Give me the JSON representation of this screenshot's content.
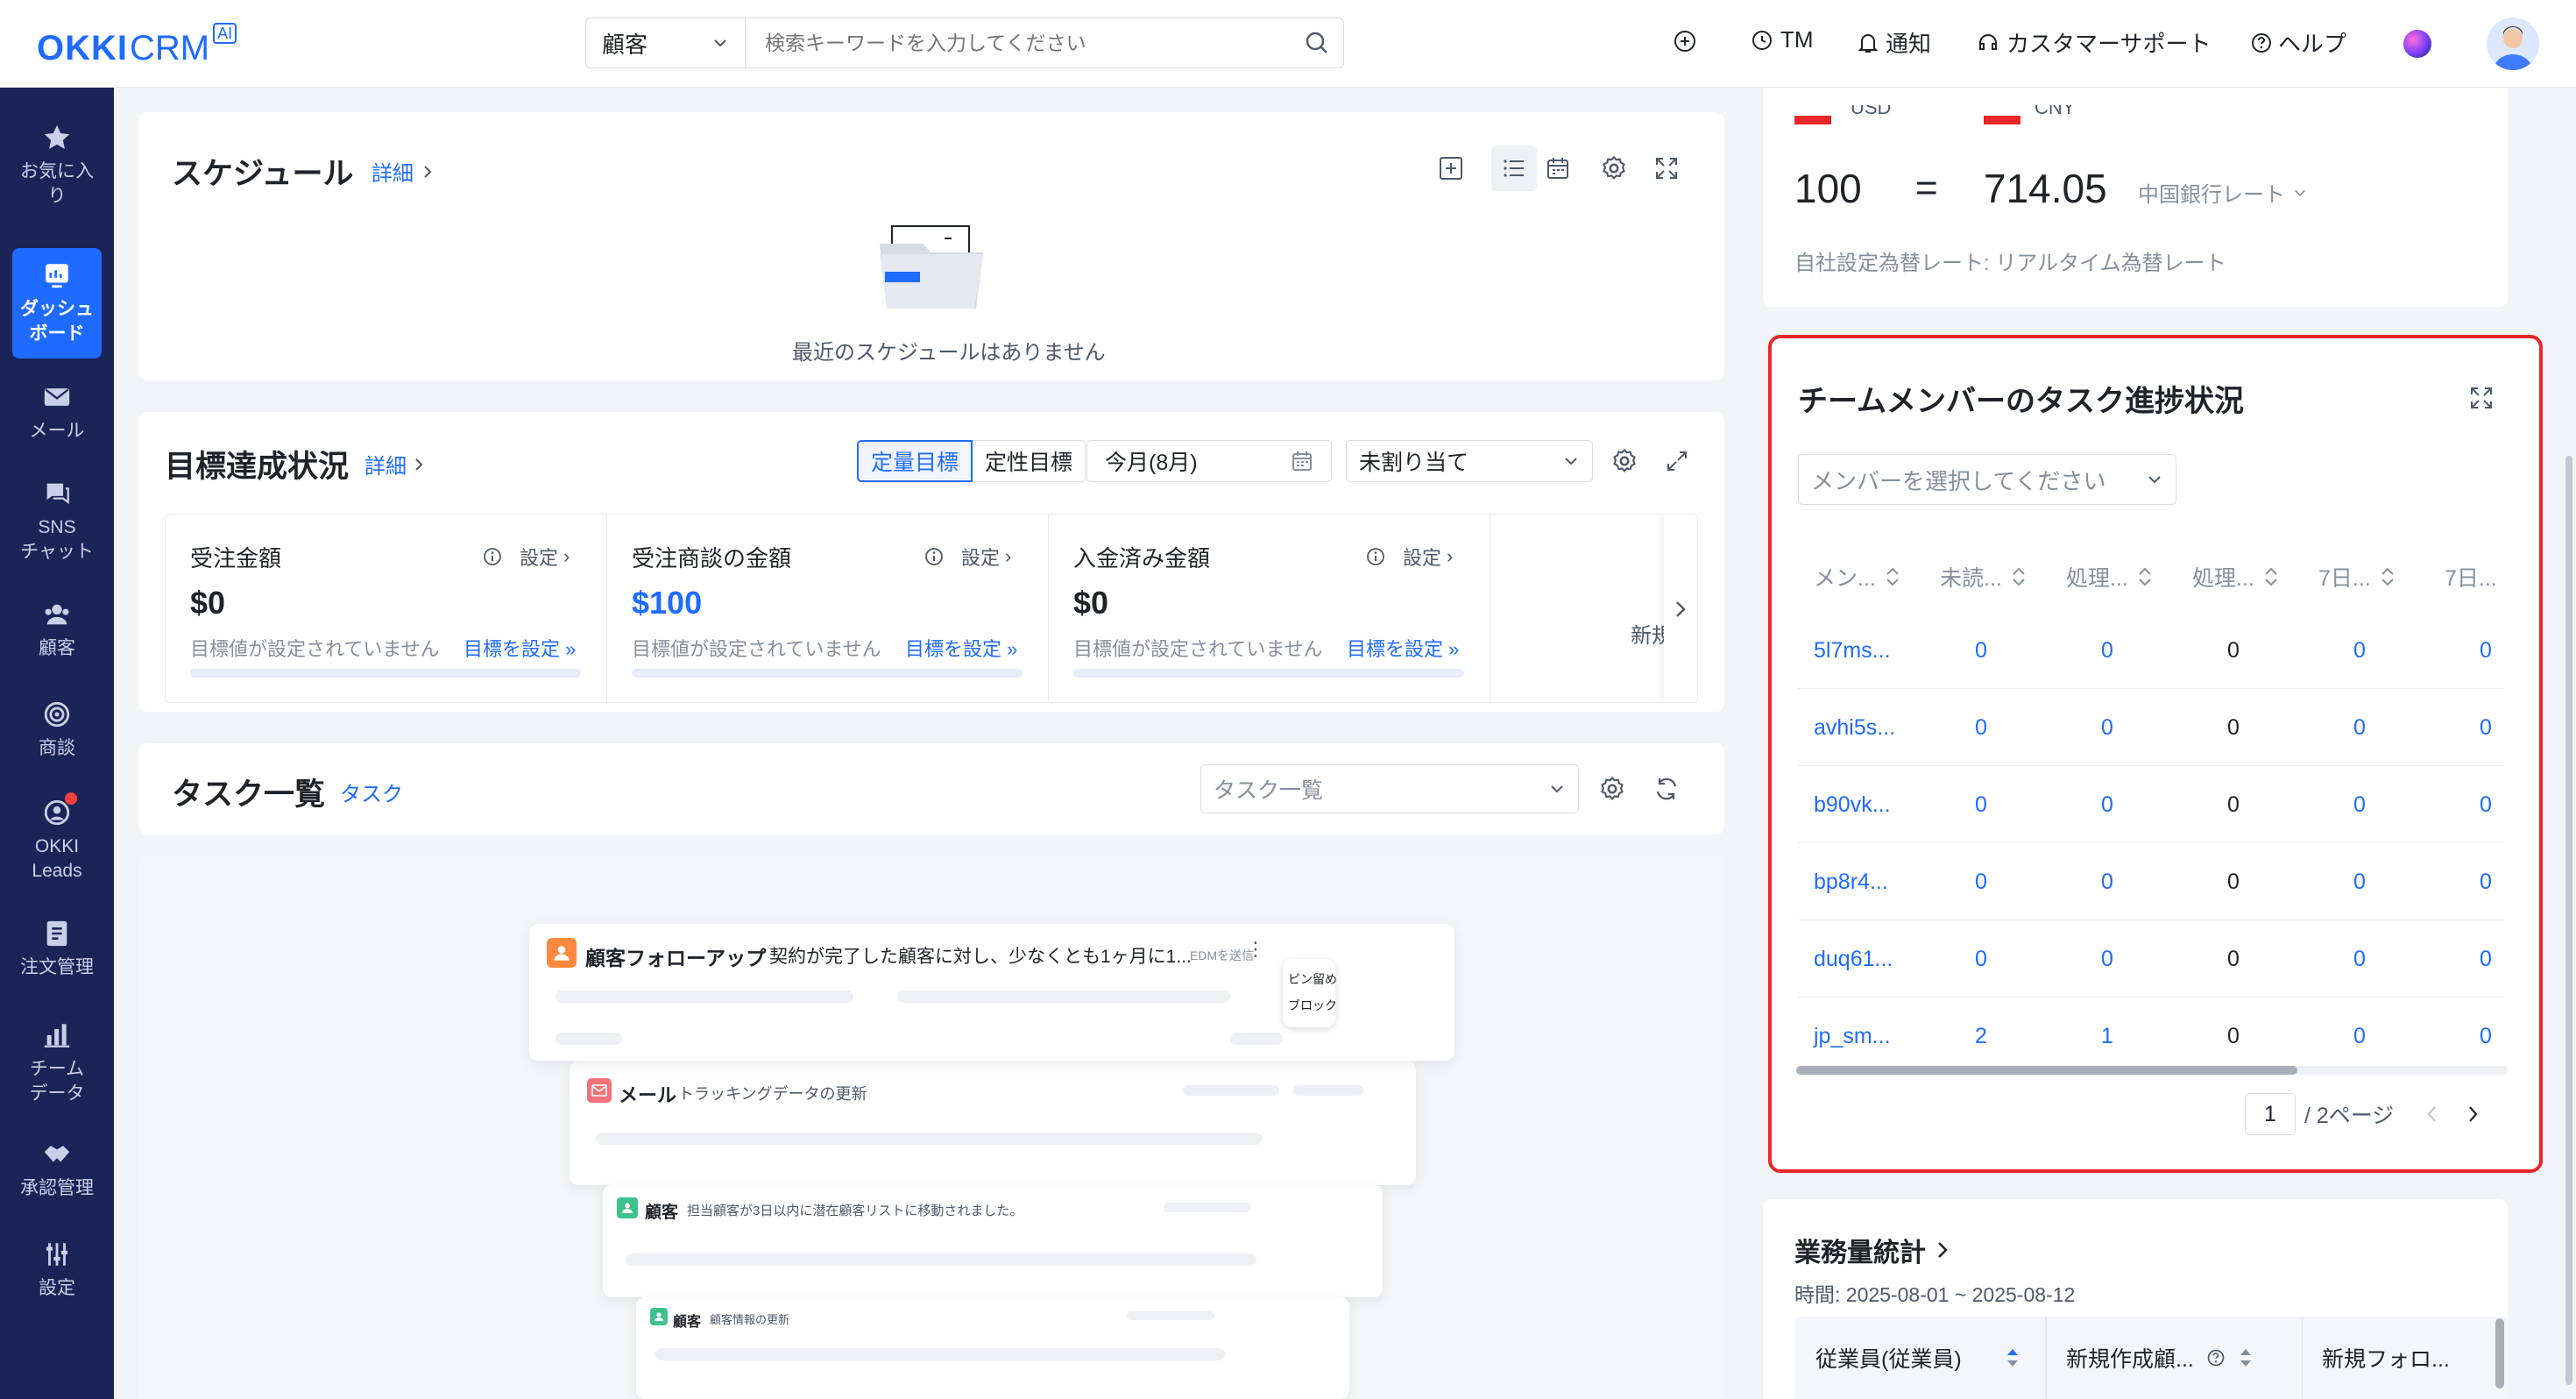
{
  "header": {
    "logo_text": "OKKI",
    "logo_crm": "CRM",
    "logo_ai": "AI",
    "search_scope": "顧客",
    "search_placeholder": "検索キーワードを入力してください",
    "tm": "TM",
    "notify": "通知",
    "support": "カスタマーサポート",
    "help": "ヘルプ"
  },
  "sidebar": {
    "items": [
      {
        "label": "お気に入り",
        "icon": "star-icon"
      },
      {
        "label": "ダッシュボード",
        "icon": "dashboard-icon"
      },
      {
        "label": "メール",
        "icon": "mail-icon"
      },
      {
        "label": "SNS\nチャット",
        "icon": "chat-icon"
      },
      {
        "label": "顧客",
        "icon": "customer-icon"
      },
      {
        "label": "商談",
        "icon": "target-icon"
      },
      {
        "label": "OKKI\nLeads",
        "icon": "leads-icon"
      },
      {
        "label": "注文管理",
        "icon": "order-icon"
      },
      {
        "label": "チーム\nデータ",
        "icon": "chart-icon"
      },
      {
        "label": "承認管理",
        "icon": "handshake-icon"
      },
      {
        "label": "設定",
        "icon": "sliders-icon"
      }
    ]
  },
  "schedule": {
    "title": "スケジュール",
    "detail": "詳細",
    "empty": "最近のスケジュールはありません"
  },
  "goals": {
    "title": "目標達成状況",
    "detail": "詳細",
    "tab_quant": "定量目標",
    "tab_qual": "定性目標",
    "period": "今月(8月)",
    "assign": "未割り当て",
    "metrics": [
      {
        "label": "受注金額",
        "setting": "設定",
        "value": "$0",
        "note": "目標値が設定されていません",
        "set": "目標を設定 »"
      },
      {
        "label": "受注商談の金額",
        "setting": "設定",
        "value": "$100",
        "note": "目標値が設定されていません",
        "set": "目標を設定 »"
      },
      {
        "label": "入金済み金額",
        "setting": "設定",
        "value": "$0",
        "note": "目標値が設定されていません",
        "set": "目標を設定 »"
      }
    ],
    "more": "新規"
  },
  "tasks": {
    "title": "タスク一覧",
    "sub": "タスク",
    "select": "タスク一覧",
    "preview": {
      "c1_title": "顧客フォローアップ",
      "c1_text": "契約が完了した顧客に対し、少なくとも1ヶ月に1...",
      "c1_edm": "EDMを送信",
      "menu_pin": "ピン留め",
      "menu_block": "ブロック",
      "c2_title": "メール",
      "c2_text": "トラッキングデータの更新",
      "c3_title": "顧客",
      "c3_text": "担当顧客が3日以内に潜在顧客リストに移動されました。",
      "c4_title": "顧客",
      "c4_text": "顧客情報の更新"
    }
  },
  "fx": {
    "cur1": "USD",
    "cur2": "CNY",
    "amount": "100",
    "eq": "=",
    "result": "714.05",
    "rate_src": "中国銀行レート",
    "note": "自社設定為替レート: リアルタイム為替レート"
  },
  "team": {
    "title": "チームメンバーのタスク進捗状況",
    "member_placeholder": "メンバーを選択してください",
    "columns": [
      "メン...",
      "未読...",
      "処理...",
      "処理...",
      "7日...",
      "7日..."
    ],
    "rows": [
      [
        "5l7ms...",
        "0",
        "0",
        "0",
        "0",
        "0"
      ],
      [
        "avhi5s...",
        "0",
        "0",
        "0",
        "0",
        "0"
      ],
      [
        "b90vk...",
        "0",
        "0",
        "0",
        "0",
        "0"
      ],
      [
        "bp8r4...",
        "0",
        "0",
        "0",
        "0",
        "0"
      ],
      [
        "duq61...",
        "0",
        "0",
        "0",
        "0",
        "0"
      ],
      [
        "jp_sm...",
        "2",
        "1",
        "0",
        "0",
        "0"
      ]
    ],
    "page": "1",
    "total": "/ 2ページ"
  },
  "workload": {
    "title": "業務量統計",
    "period": "時間: 2025-08-01 ~ 2025-08-12",
    "col1": "従業員(従業員)",
    "col2": "新規作成顧...",
    "col3": "新規フォロ..."
  },
  "colors": {
    "accent": "#1f6bff",
    "sidebar": "#1b2457",
    "highlight": "#e8262b"
  }
}
